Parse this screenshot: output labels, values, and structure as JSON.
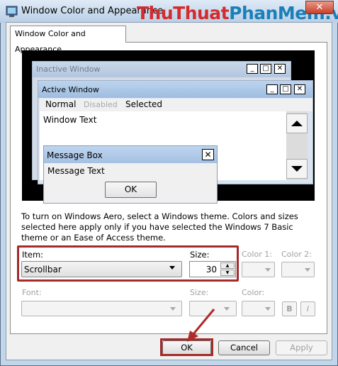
{
  "window": {
    "title": "Window Color and Appearance",
    "watermark_part1": "ThuThuat",
    "watermark_part2": "PhanMem.vn",
    "close_glyph": "✕",
    "icon": "window-color-icon"
  },
  "tab": {
    "label": "Window Color and Appearance"
  },
  "preview": {
    "inactive_title": "Inactive Window",
    "active_title": "Active Window",
    "menu": {
      "normal": "Normal",
      "disabled": "Disabled",
      "selected": "Selected"
    },
    "window_text": "Window Text",
    "caption_buttons": {
      "minimize": "_",
      "maximize": "□",
      "close": "✕"
    },
    "message_box": {
      "title": "Message Box",
      "text": "Message Text",
      "ok": "OK",
      "close": "✕"
    }
  },
  "description": "To turn on Windows Aero, select a Windows theme.  Colors and sizes selected here apply only if you have selected the Windows 7 Basic theme or an Ease of Access theme.",
  "item": {
    "label": "Item:",
    "value": "Scrollbar"
  },
  "item_size": {
    "label": "Size:",
    "value": "30"
  },
  "color1": {
    "label": "Color 1:"
  },
  "color2": {
    "label": "Color 2:"
  },
  "font": {
    "label": "Font:",
    "value": ""
  },
  "font_size": {
    "label": "Size:"
  },
  "font_color": {
    "label": "Color:"
  },
  "bold": "B",
  "italic": "I",
  "buttons": {
    "ok": "OK",
    "cancel": "Cancel",
    "apply": "Apply"
  },
  "colors": {
    "highlight": "#a52a2a",
    "watermark_red": "#d42c2c",
    "watermark_blue": "#1b7fb8"
  }
}
